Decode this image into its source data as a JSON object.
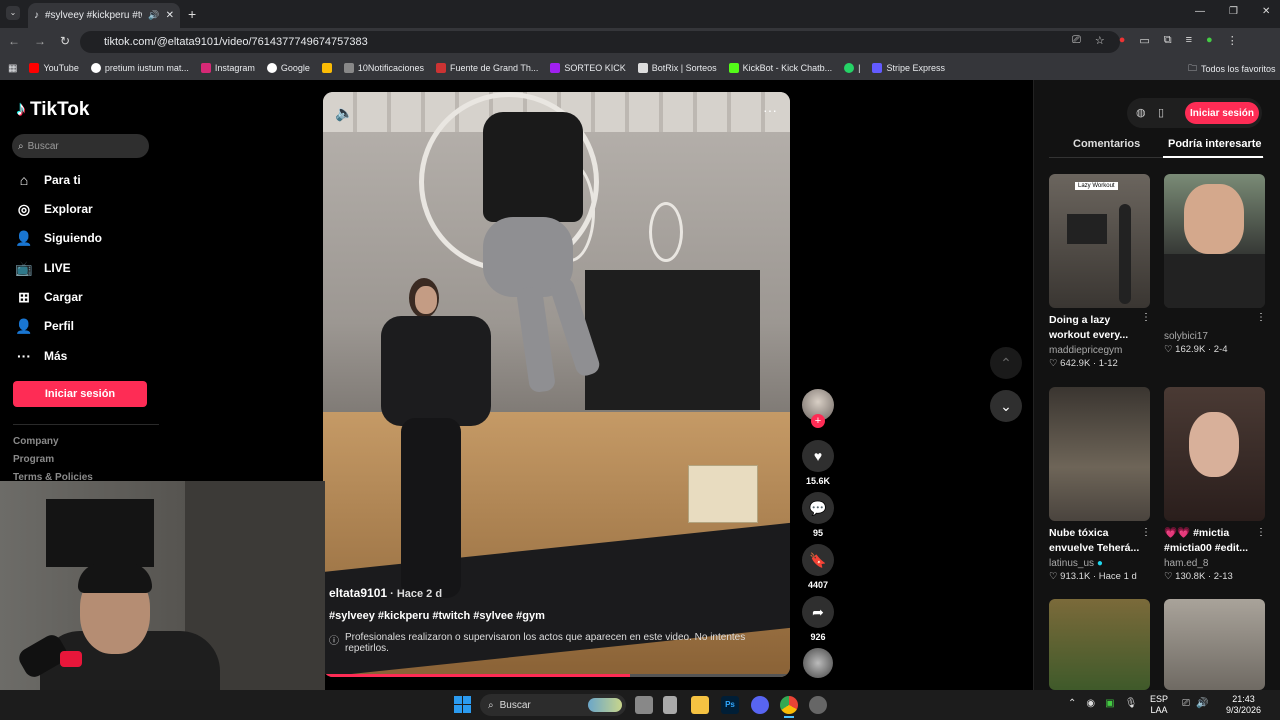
{
  "browser": {
    "tab_title": "#sylveey #kickperu #twitch",
    "url": "tiktok.com/@eltata9101/video/7614377749674757383",
    "bookmarks": [
      "YouTube",
      "pretium iustum mat...",
      "Instagram",
      "Google",
      "10Notificaciones",
      "Fuente de Grand Th...",
      "SORTEO KICK",
      "BotRix | Sorteos",
      "KickBot - Kick Chatb...",
      "|",
      "Stripe Express"
    ],
    "all_favorites": "Todos los favoritos"
  },
  "sidebar": {
    "logo": "TikTok",
    "search_placeholder": "Buscar",
    "items": [
      {
        "label": "Para ti",
        "icon": "home-icon"
      },
      {
        "label": "Explorar",
        "icon": "compass-icon"
      },
      {
        "label": "Siguiendo",
        "icon": "following-icon"
      },
      {
        "label": "LIVE",
        "icon": "live-icon"
      },
      {
        "label": "Cargar",
        "icon": "upload-icon"
      },
      {
        "label": "Perfil",
        "icon": "profile-icon"
      },
      {
        "label": "Más",
        "icon": "more-icon"
      }
    ],
    "login": "Iniciar sesión",
    "footer": [
      "Company",
      "Program",
      "Terms & Policies"
    ]
  },
  "video": {
    "username": "eltata9101",
    "time": "· Hace 2 d",
    "tags": "#sylveey #kickperu #twitch #sylvee #gym",
    "warning": "Profesionales realizaron o supervisaron los actos que aparecen en este video. No intentes repetirlos.",
    "progress": 0.66
  },
  "actions": {
    "likes": "15.6K",
    "comments": "95",
    "saves": "4407",
    "shares": "926"
  },
  "right_panel": {
    "login": "Iniciar sesión",
    "tab_comments": "Comentarios",
    "tab_interest": "Podría interesarte",
    "cards": [
      {
        "title": "Doing a lazy workout every...",
        "user": "maddiepricegym",
        "likes": "642.9K",
        "date": "1-12",
        "thumb_text": "Lazy Workout"
      },
      {
        "title": "",
        "user": "solybici17",
        "likes": "162.9K",
        "date": "2-4"
      },
      {
        "title": "Nube tóxica envuelve Teherá...",
        "user": "latinus_us",
        "likes": "913.1K",
        "date": "Hace 1 d"
      },
      {
        "title": "💗💗 #mictia #mictia00 #edit...",
        "user": "ham.ed_8",
        "likes": "130.8K",
        "date": "2-13"
      }
    ]
  },
  "taskbar": {
    "search": "Buscar",
    "lang1": "ESP",
    "lang2": "LAA",
    "time": "21:43",
    "date": "9/3/2026"
  }
}
